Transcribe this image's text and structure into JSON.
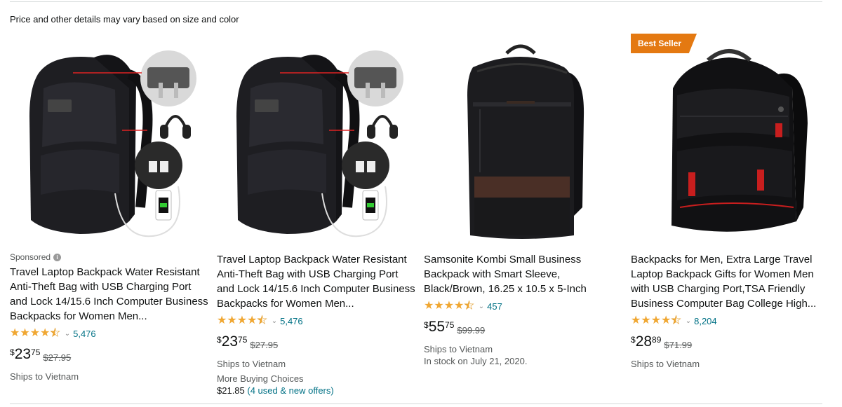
{
  "notice": "Price and other details may vary based on size and color",
  "products": [
    {
      "sponsored_label": "Sponsored",
      "title": "Travel Laptop Backpack Water Resistant Anti-Theft Bag with USB Charging Port and Lock 14/15.6 Inch Computer Business Backpacks for Women Men...",
      "rating": 4.5,
      "reviews": "5,476",
      "price_symbol": "$",
      "price_whole": "23",
      "price_fraction": "75",
      "list_price": "$27.95",
      "shipping": "Ships to Vietnam",
      "image": "travel-usb-backpack"
    },
    {
      "title": "Travel Laptop Backpack Water Resistant Anti-Theft Bag with USB Charging Port and Lock 14/15.6 Inch Computer Business Backpacks for Women Men...",
      "rating": 4.5,
      "reviews": "5,476",
      "price_symbol": "$",
      "price_whole": "23",
      "price_fraction": "75",
      "list_price": "$27.95",
      "shipping": "Ships to Vietnam",
      "more_buying_label": "More Buying Choices",
      "more_buying_price": "$21.85",
      "more_buying_offers": "(4 used & new offers)",
      "image": "travel-usb-backpack"
    },
    {
      "title": "Samsonite Kombi Small Business Backpack with Smart Sleeve, Black/Brown, 16.25 x 10.5 x 5-Inch",
      "rating": 4.5,
      "reviews": "457",
      "price_symbol": "$",
      "price_whole": "55",
      "price_fraction": "75",
      "list_price": "$99.99",
      "shipping": "Ships to Vietnam",
      "stock": "In stock on July 21, 2020.",
      "image": "samsonite-backpack"
    },
    {
      "badge": "Best Seller",
      "title": "Backpacks for Men, Extra Large Travel Laptop Backpack Gifts for Women Men with USB Charging Port,TSA Friendly Business Computer Bag College High...",
      "rating": 4.5,
      "reviews": "8,204",
      "price_symbol": "$",
      "price_whole": "28",
      "price_fraction": "89",
      "list_price": "$71.99",
      "shipping": "Ships to Vietnam",
      "image": "extra-large-backpack"
    }
  ]
}
